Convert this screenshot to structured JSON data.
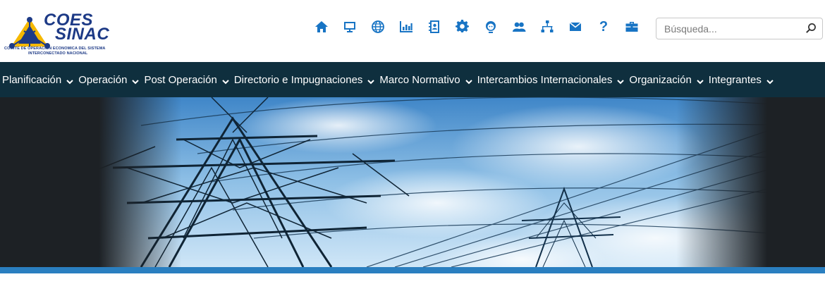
{
  "logo": {
    "line1": "COES",
    "line2": "SINAC",
    "subtitle1": "COMITE DE OPERACION ECONOMICA DEL SISTEMA",
    "subtitle2": "INTERCONECTADO NACIONAL"
  },
  "toolbar_icons": [
    "home-icon",
    "monitor-icon",
    "globe-icon",
    "chart-icon",
    "contacts-icon",
    "gear-icon",
    "user-icon",
    "group-icon",
    "sitemap-icon",
    "mail-icon",
    "help-icon",
    "briefcase-icon"
  ],
  "help_glyph": "?",
  "search": {
    "placeholder": "Búsqueda..."
  },
  "nav": {
    "items": [
      "Planificación",
      "Operación",
      "Post Operación",
      "Directorio e Impugnaciones",
      "Marco Normativo",
      "Intercambios Internacionales",
      "Organización",
      "Integrantes"
    ]
  },
  "colors": {
    "brand_blue": "#1d3a86",
    "icon_blue": "#1874c4",
    "nav_bg": "#0f2f3e",
    "accent_bar": "#2a7fc0",
    "logo_yellow": "#f5b800"
  }
}
